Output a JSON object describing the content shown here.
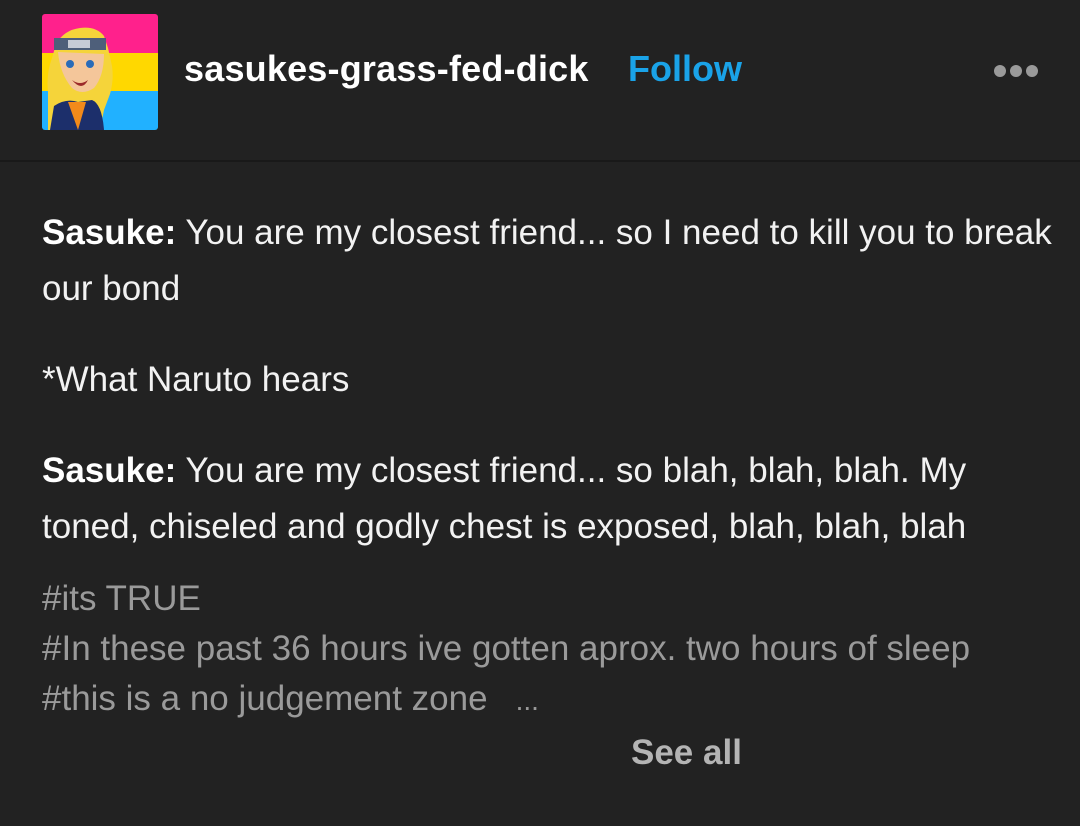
{
  "header": {
    "username": "sasukes-grass-fed-dick",
    "follow_label": "Follow",
    "more_icon": "more-dots-icon",
    "avatar_flag_colors": [
      "#ff218c",
      "#ffd800",
      "#21b1ff"
    ]
  },
  "post": {
    "paragraphs": [
      {
        "speaker": "Sasuke:",
        "text": " You are my closest friend... so I need to kill you to break our bond"
      },
      {
        "speaker": "",
        "text": "*What Naruto hears"
      },
      {
        "speaker": "Sasuke:",
        "text": " You are my closest friend... so blah, blah, blah. My toned, chiseled and godly chest is exposed, blah, blah, blah"
      }
    ]
  },
  "tags": {
    "items": [
      "#its TRUE",
      "#In these past 36 hours ive gotten aprox. two hours of sleep",
      "#this is a no judgement zone"
    ],
    "ellipsis": "...",
    "see_all_label": "See all"
  },
  "colors": {
    "background": "#222222",
    "accent": "#1aa3e8",
    "tag_text": "#9a9a9a"
  }
}
